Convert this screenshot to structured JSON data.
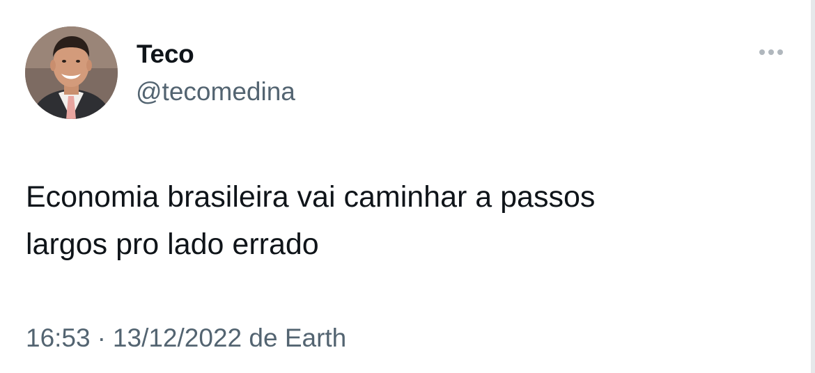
{
  "author": {
    "display_name": "Teco",
    "handle": "@tecomedina"
  },
  "tweet": {
    "text_lines": [
      "Economia brasileira vai caminhar a passos",
      "largos pro lado errado"
    ],
    "time": "16:53",
    "separator": "·",
    "date": "13/12/2022",
    "source_prefix": "de",
    "source": "Earth"
  },
  "icons": {
    "more": "more-horizontal-icon"
  }
}
